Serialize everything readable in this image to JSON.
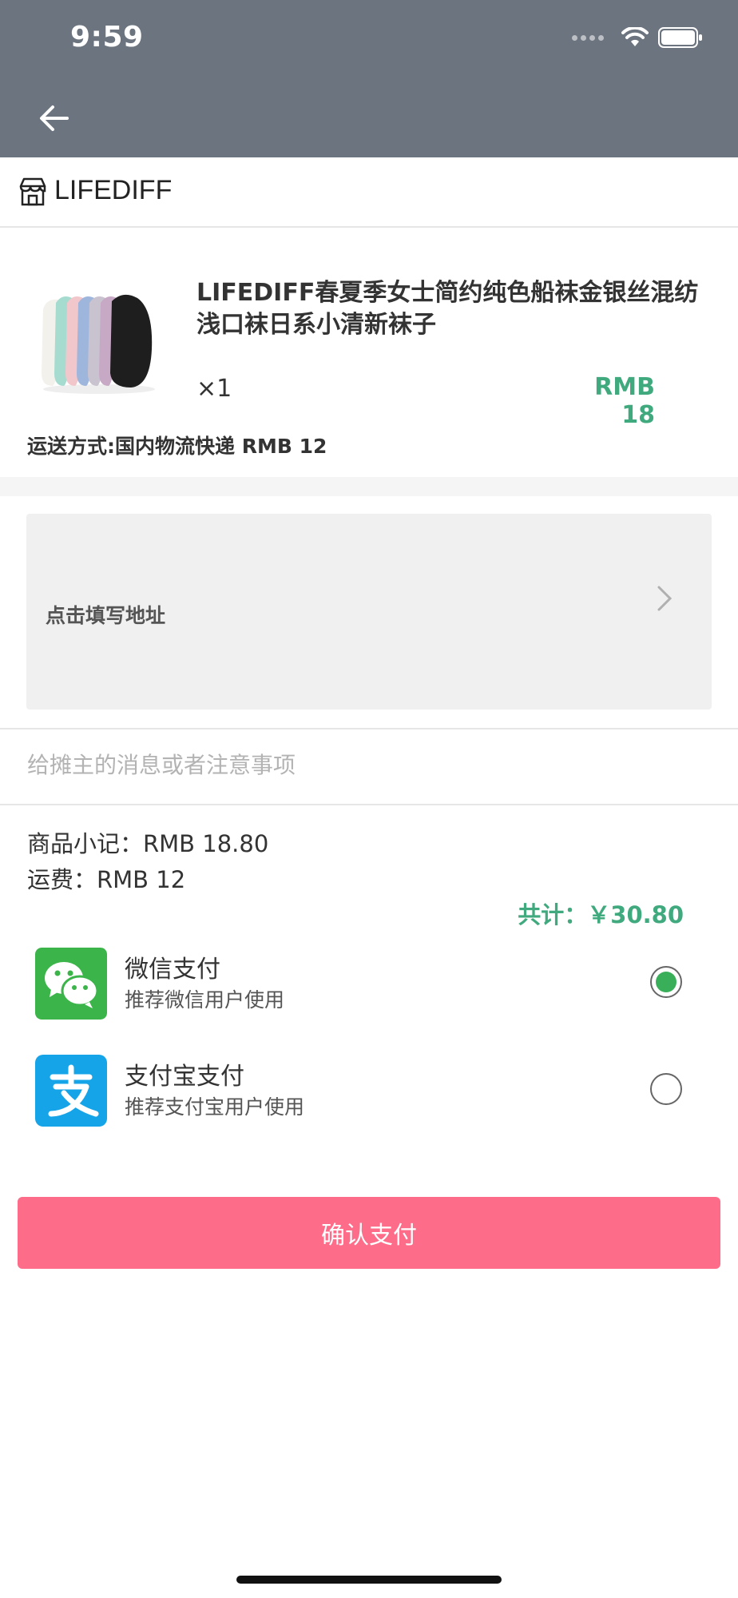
{
  "status_bar": {
    "time": "9:59"
  },
  "store": {
    "name": "LIFEDIFF"
  },
  "product": {
    "title": "LIFEDIFF春夏季女士简约纯色船袜金银丝混纺浅口袜日系小清新袜子",
    "quantity": "×1",
    "price": "RMB 18",
    "shipping": "运送方式:国内物流快递 RMB 12"
  },
  "address": {
    "label": "点击填写地址"
  },
  "message": {
    "placeholder": "给摊主的消息或者注意事项",
    "value": ""
  },
  "totals": {
    "subtotal": "商品小记：RMB 18.80",
    "freight": "运费：RMB 12",
    "total": "共计：￥30.80"
  },
  "payment": {
    "options": [
      {
        "title": "微信支付",
        "subtitle": "推荐微信用户使用",
        "selected": true,
        "icon": "wechat-icon",
        "color": "#3bb44a"
      },
      {
        "title": "支付宝支付",
        "subtitle": "推荐支付宝用户使用",
        "selected": false,
        "icon": "alipay-icon",
        "color": "#16a4e9"
      }
    ]
  },
  "confirm": {
    "label": "确认支付"
  },
  "colors": {
    "header": "#6c747f",
    "accent": "#41a97e",
    "button": "#fd6c89"
  }
}
